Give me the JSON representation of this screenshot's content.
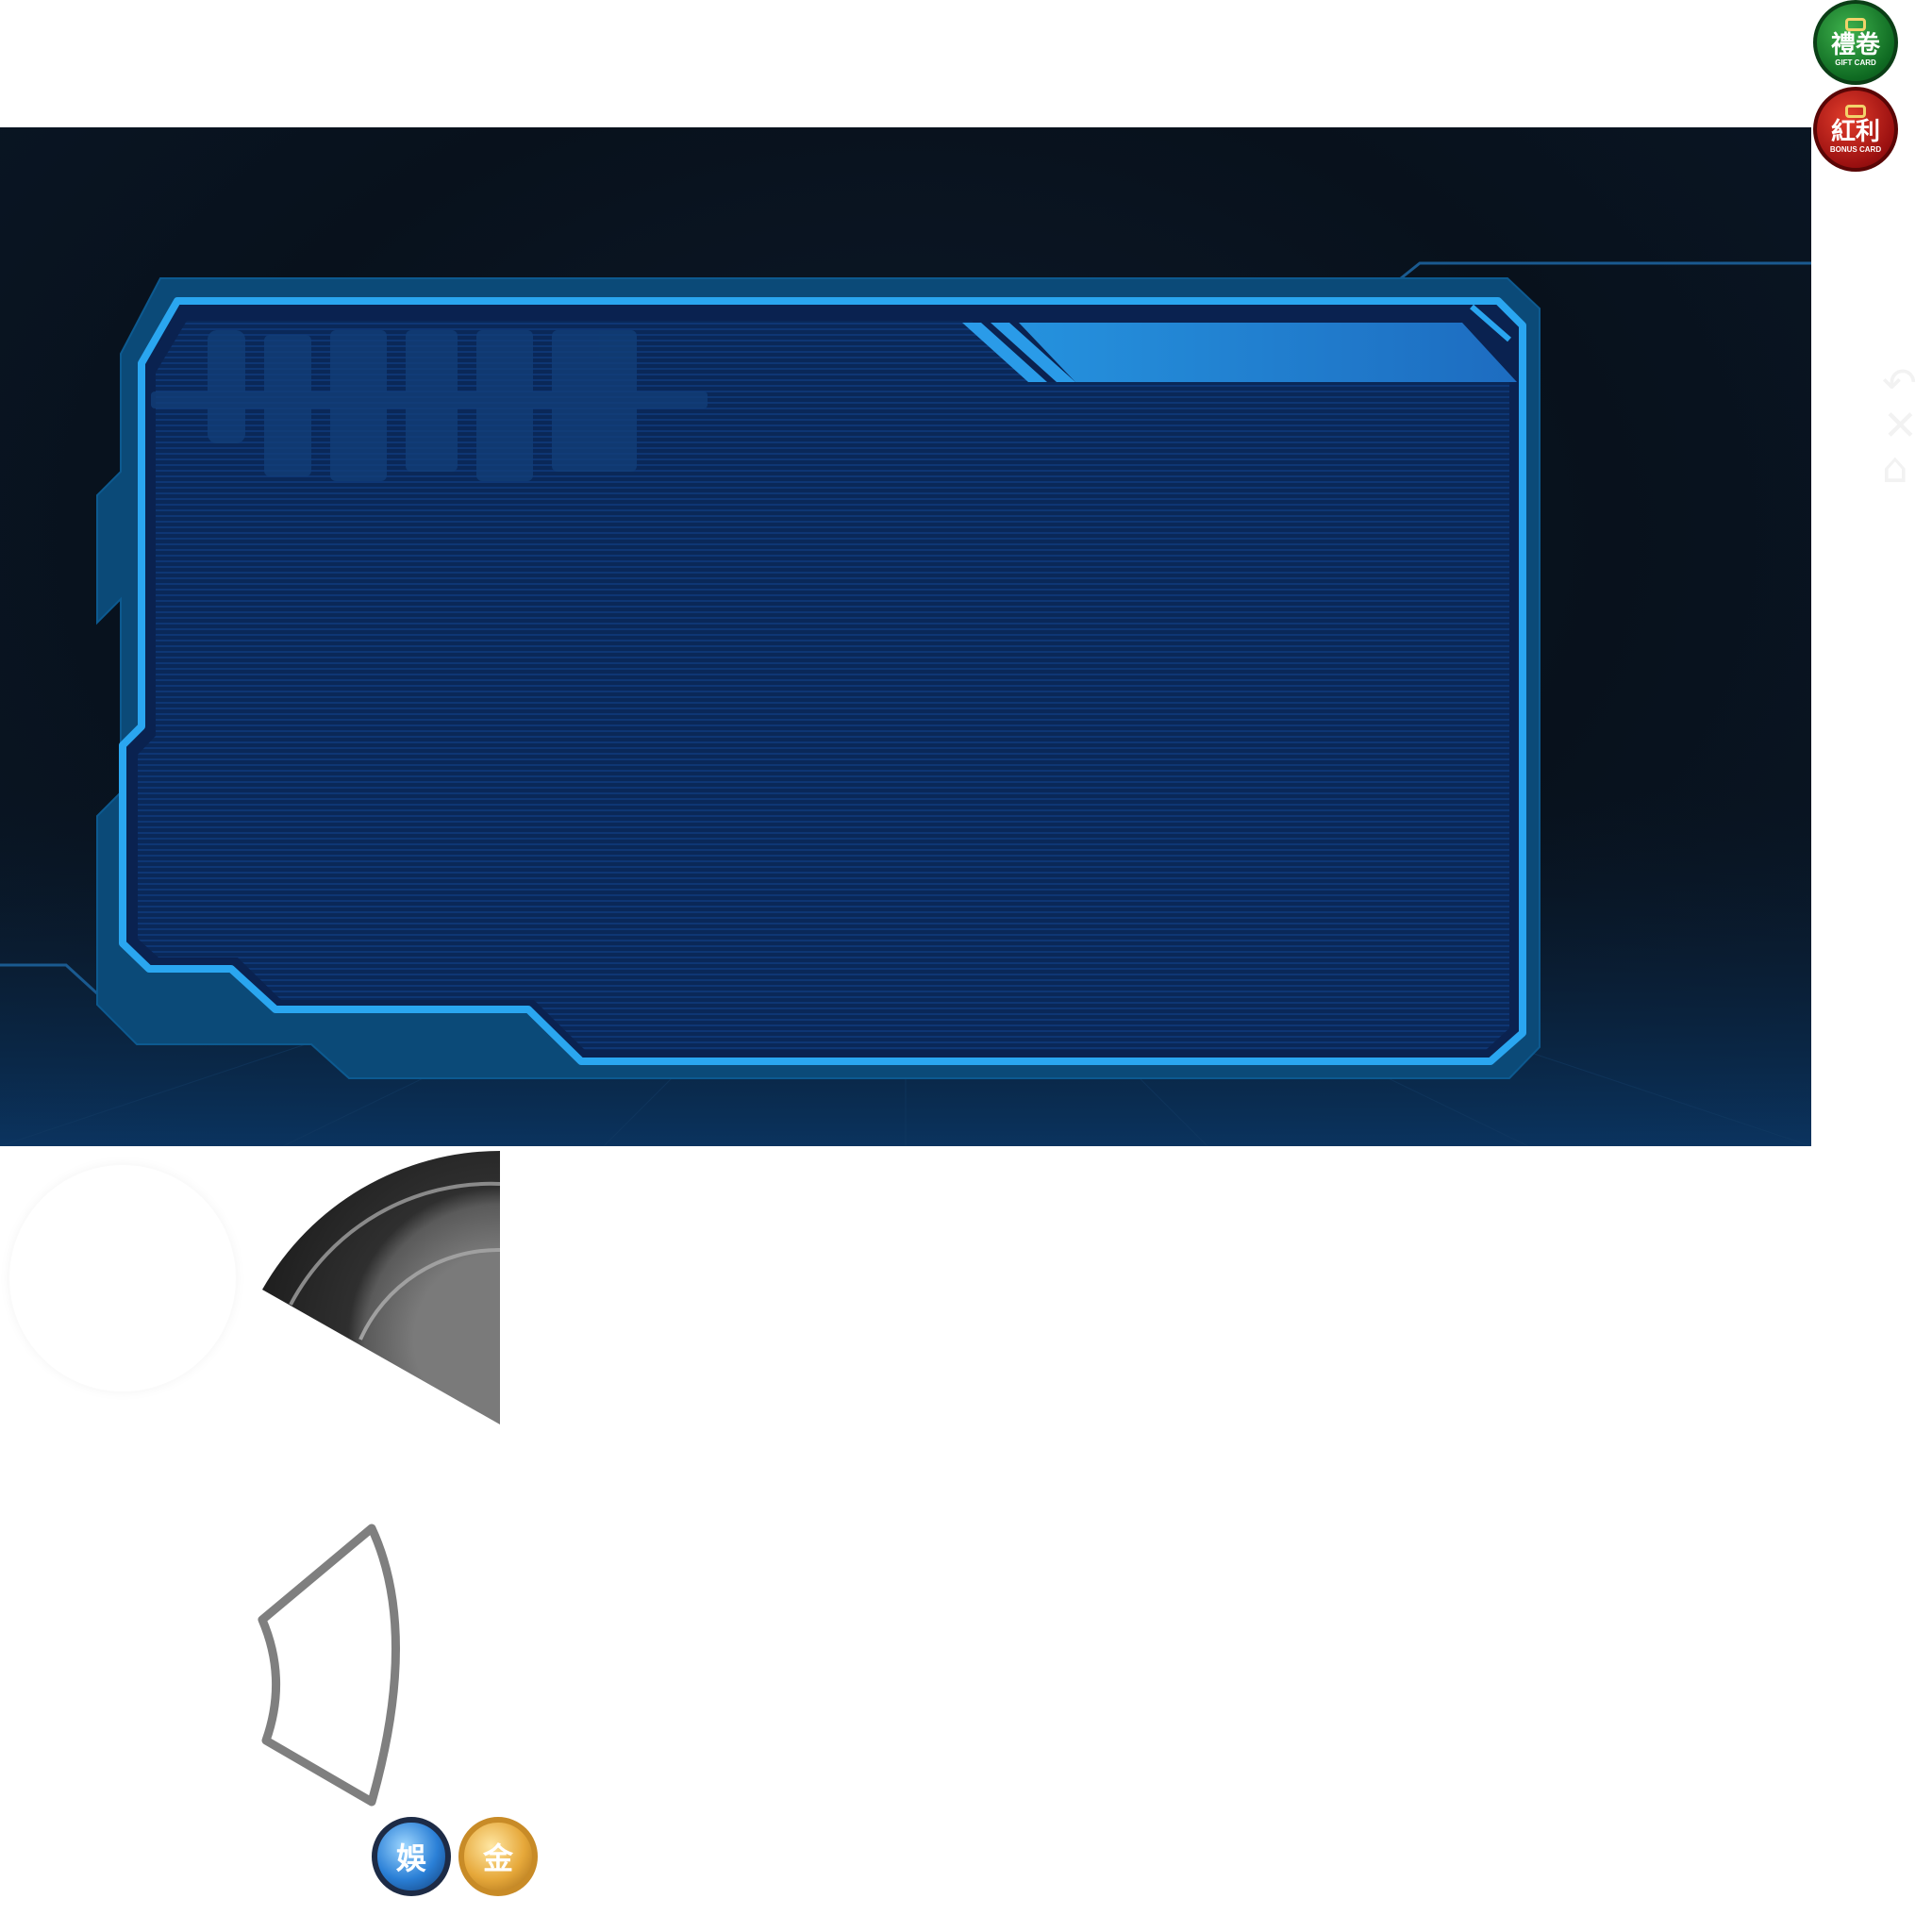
{
  "badges": {
    "gift": {
      "title": "禮卷",
      "subtitle": "GIFT CARD",
      "color": "#1f8a34"
    },
    "bonus": {
      "title": "紅利",
      "subtitle": "BONUS CARD",
      "color": "#b41414"
    }
  },
  "side_icons": [
    "back-icon",
    "close-icon",
    "home-icon"
  ],
  "coins": {
    "entertainment": "娛",
    "gold": "金"
  },
  "colors": {
    "panel_bg": "#08111c",
    "frame_blue": "#1f8ee6",
    "frame_dark": "#0b4e7e",
    "screen_bg": "#0a2a5e"
  }
}
